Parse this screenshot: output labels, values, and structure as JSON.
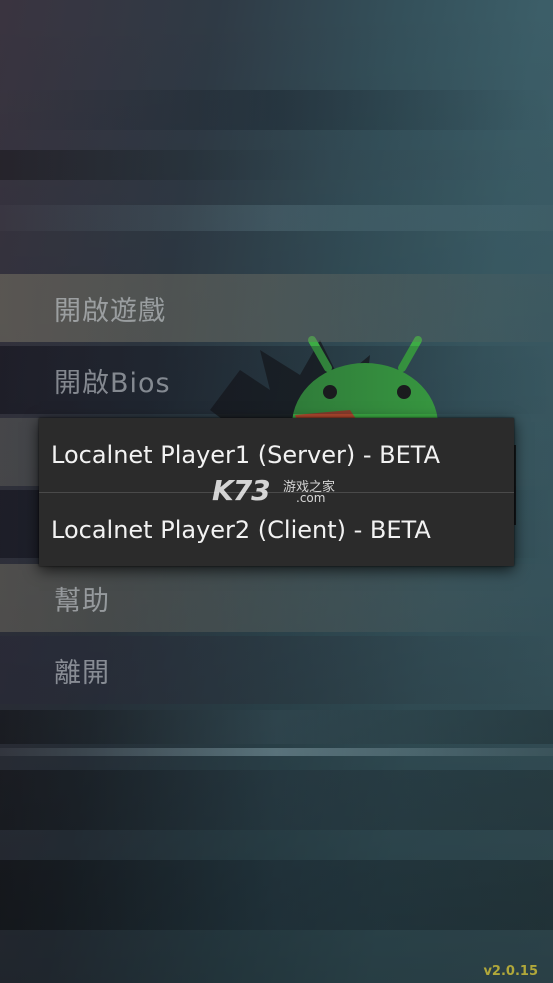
{
  "menu": {
    "items": [
      {
        "label": "開啟遊戲"
      },
      {
        "label": "開啟Bios"
      },
      {
        "label": ""
      },
      {
        "label": ""
      },
      {
        "label": "幫助"
      },
      {
        "label": "離開"
      }
    ]
  },
  "popup": {
    "options": [
      {
        "label": "Localnet Player1 (Server) - BETA"
      },
      {
        "label": "Localnet Player2 (Client) - BETA"
      }
    ]
  },
  "watermark": {
    "brand": "K73",
    "tagline": "游戏之家",
    "domain": ".com"
  },
  "version": "v2.0.15",
  "colors": {
    "android_green": "#3dac45",
    "popup_bg": "#2b2b2b",
    "version_text": "#b1a83a"
  },
  "icons": [
    "android-logo-icon"
  ]
}
